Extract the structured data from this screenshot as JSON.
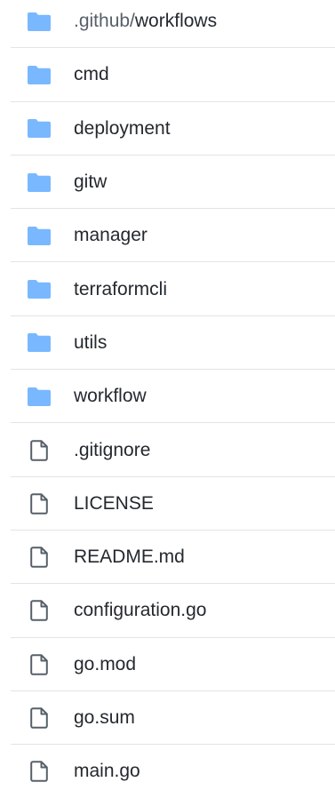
{
  "colors": {
    "folder_icon": "#79b8ff",
    "file_icon": "#57606a",
    "divider": "#e1e4e8",
    "text": "#24292f",
    "muted_text": "#57606a"
  },
  "entries": [
    {
      "type": "folder",
      "icon": "folder-icon",
      "prefix": ".github/",
      "name": "workflows"
    },
    {
      "type": "folder",
      "icon": "folder-icon",
      "name": "cmd"
    },
    {
      "type": "folder",
      "icon": "folder-icon",
      "name": "deployment"
    },
    {
      "type": "folder",
      "icon": "folder-icon",
      "name": "gitw"
    },
    {
      "type": "folder",
      "icon": "folder-icon",
      "name": "manager"
    },
    {
      "type": "folder",
      "icon": "folder-icon",
      "name": "terraformcli"
    },
    {
      "type": "folder",
      "icon": "folder-icon",
      "name": "utils"
    },
    {
      "type": "folder",
      "icon": "folder-icon",
      "name": "workflow"
    },
    {
      "type": "file",
      "icon": "file-icon",
      "name": ".gitignore"
    },
    {
      "type": "file",
      "icon": "file-icon",
      "name": "LICENSE"
    },
    {
      "type": "file",
      "icon": "file-icon",
      "name": "README.md"
    },
    {
      "type": "file",
      "icon": "file-icon",
      "name": "configuration.go"
    },
    {
      "type": "file",
      "icon": "file-icon",
      "name": "go.mod"
    },
    {
      "type": "file",
      "icon": "file-icon",
      "name": "go.sum"
    },
    {
      "type": "file",
      "icon": "file-icon",
      "name": "main.go"
    }
  ]
}
